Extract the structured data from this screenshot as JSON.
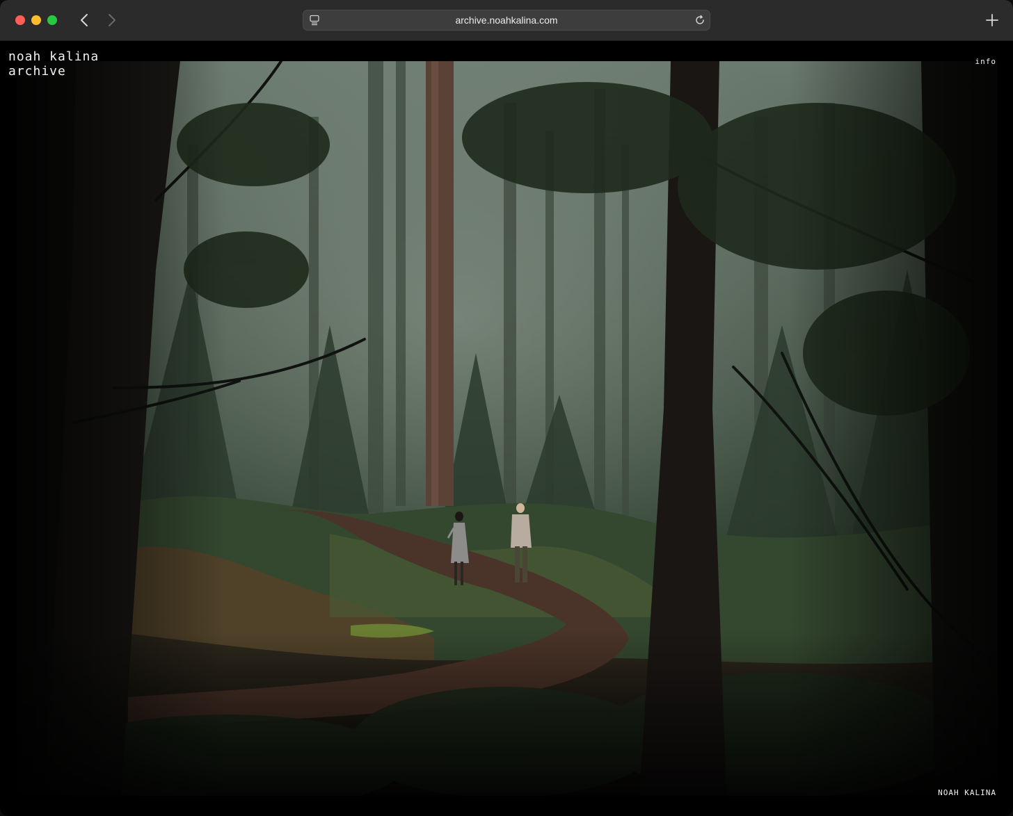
{
  "browser": {
    "url": "archive.noahkalina.com",
    "icons": {
      "back": "chevron-left-icon",
      "forward": "chevron-right-icon",
      "site": "page-menu-icon",
      "reload": "reload-icon",
      "new_tab": "plus-icon"
    }
  },
  "site": {
    "title_line1": "noah kalina",
    "title_line2": "archive",
    "info_link": "info",
    "credit": "NOAH KALINA"
  },
  "photo": {
    "subject": "Two people standing on a dirt path in a misty redwood forest"
  },
  "colors": {
    "toolbar": "#2b2b2b",
    "page_background": "#000000",
    "text": "#f2f2f2"
  }
}
